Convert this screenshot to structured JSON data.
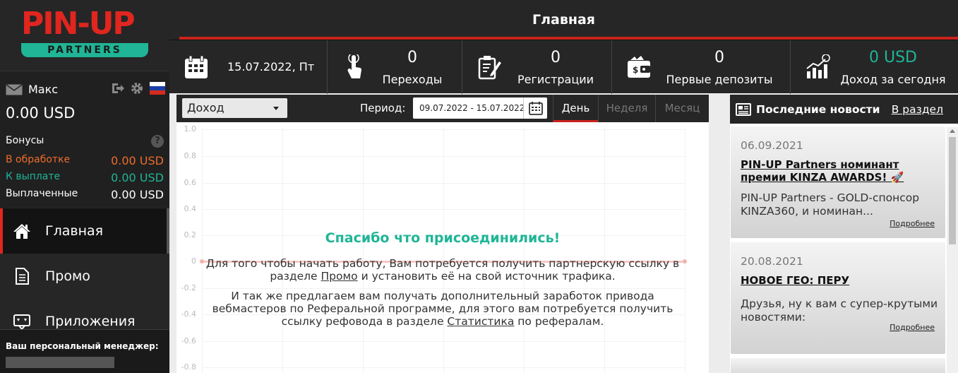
{
  "logo": {
    "main": "PIN-UP",
    "sub": "PARTNERS"
  },
  "user": {
    "name": "Макс",
    "balance": "0.00 USD"
  },
  "bonuses": {
    "title": "Бонусы",
    "help": "?",
    "rows": [
      {
        "label": "В обработке",
        "value": "0.00 USD"
      },
      {
        "label": "К выплате",
        "value": "0.00 USD"
      },
      {
        "label": "Выплаченные",
        "value": "0.00 USD"
      }
    ]
  },
  "nav": [
    {
      "label": "Главная",
      "icon": "home-icon"
    },
    {
      "label": "Промо",
      "icon": "document-icon"
    },
    {
      "label": "Приложения",
      "icon": "app-icon"
    }
  ],
  "manager": {
    "title": "Ваш персональный менеджер:"
  },
  "header": {
    "title": "Главная"
  },
  "stats": {
    "date": "15.07.2022, Пт",
    "items": [
      {
        "value": "0",
        "label": "Переходы"
      },
      {
        "value": "0",
        "label": "Регистрации"
      },
      {
        "value": "0",
        "label": "Первые депозиты"
      },
      {
        "value": "0 USD",
        "label": "Доход за сегодня"
      }
    ]
  },
  "chart_panel": {
    "select": "Доход",
    "period_label": "Период:",
    "period_value": "09.07.2022 - 15.07.2022",
    "tabs": [
      "День",
      "Неделя",
      "Месяц"
    ],
    "y_ticks": [
      "1.0",
      "0.8",
      "0.6",
      "0.4",
      "0.2",
      "0",
      "-0.2",
      "-0.4",
      "-0.6",
      "-0.8"
    ],
    "welcome_title": "Спасибо что присоединились!",
    "p1_a": "Для того чтобы начать работу, Вам потребуется получить партнерскую ссылку в разделе ",
    "p1_link": "Промо",
    "p1_b": " и установить её на свой источник трафика.",
    "p2_a": "И так же предлагаем вам получать дополнительный заработок привода вебмастеров по Реферальной программе, для этого вам потребуется получить ссылку рефовода в разделе ",
    "p2_link": "Статистика",
    "p2_b": " по рефералам."
  },
  "news": {
    "title": "Последние новости",
    "link": "В раздел",
    "items": [
      {
        "date": "06.09.2021",
        "title": "PIN-UP Partners номинант премии KINZA AWARDS! 🚀",
        "text": "PIN-UP Partners - GOLD-спонсор KINZA360, и номинан...",
        "more": "Подробнее"
      },
      {
        "date": "20.08.2021",
        "title": "НОВОЕ ГЕО: ПЕРУ",
        "text": "Друзья, ну к вам с супер-крутыми новостями:",
        "more": "Подробнее"
      }
    ]
  },
  "colors": {
    "accent_red": "#c9231c",
    "green": "#1fb596",
    "orange": "#ee6c2b",
    "dark": "#262626"
  }
}
